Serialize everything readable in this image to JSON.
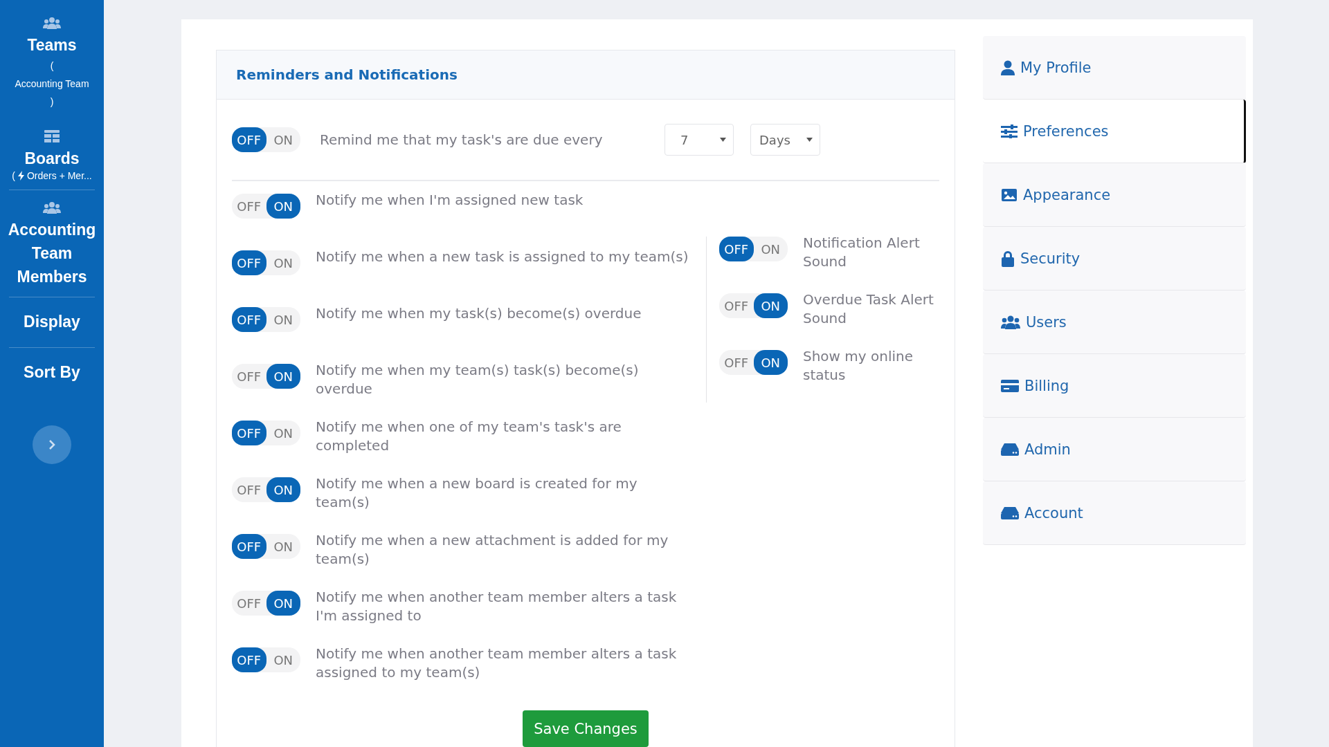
{
  "sidebar": {
    "items": [
      {
        "kind": "team",
        "title": "Teams",
        "open": "(",
        "subtitle": "Accounting Team",
        "close": ")"
      },
      {
        "kind": "board",
        "title": "Boards",
        "open": "(",
        "subtitle": "Orders + Mer..."
      },
      {
        "kind": "members",
        "title": "Accounting Team Members"
      },
      {
        "kind": "plain",
        "title": "Display"
      },
      {
        "kind": "plain",
        "title": "Sort By"
      }
    ]
  },
  "panel": {
    "title": "Reminders and Notifications",
    "reminder": {
      "toggle": {
        "off_label": "OFF",
        "on_label": "ON",
        "on": false
      },
      "text": "Remind me that my task's are due every",
      "count": "7",
      "unit": "Days"
    },
    "left_settings": [
      {
        "toggle": {
          "off_label": "OFF",
          "on_label": "ON",
          "on": true
        },
        "text": "Notify me when I'm assigned new task"
      },
      {
        "toggle": {
          "off_label": "OFF",
          "on_label": "ON",
          "on": false
        },
        "text": "Notify me when a new task is assigned to my team(s)"
      },
      {
        "toggle": {
          "off_label": "OFF",
          "on_label": "ON",
          "on": false
        },
        "text": "Notify me when my task(s) become(s) overdue"
      },
      {
        "toggle": {
          "off_label": "OFF",
          "on_label": "ON",
          "on": true
        },
        "text": "Notify me when my team(s) task(s) become(s) overdue"
      },
      {
        "toggle": {
          "off_label": "OFF",
          "on_label": "ON",
          "on": false
        },
        "text": "Notify me when one of my team's task's are completed"
      },
      {
        "toggle": {
          "off_label": "OFF",
          "on_label": "ON",
          "on": true
        },
        "text": "Notify me when a new board is created for my team(s)"
      },
      {
        "toggle": {
          "off_label": "OFF",
          "on_label": "ON",
          "on": false
        },
        "text": "Notify me when a new attachment is added for my team(s)"
      },
      {
        "toggle": {
          "off_label": "OFF",
          "on_label": "ON",
          "on": true
        },
        "text": "Notify me when another team member alters a task I'm assigned to"
      },
      {
        "toggle": {
          "off_label": "OFF",
          "on_label": "ON",
          "on": false
        },
        "text": "Notify me when another team member alters a task assigned to my team(s)"
      }
    ],
    "right_settings": [
      {
        "toggle": {
          "off_label": "OFF",
          "on_label": "ON",
          "on": false
        },
        "text": "Notification Alert Sound"
      },
      {
        "toggle": {
          "off_label": "OFF",
          "on_label": "ON",
          "on": true
        },
        "text": "Overdue Task Alert Sound"
      },
      {
        "toggle": {
          "off_label": "OFF",
          "on_label": "ON",
          "on": true
        },
        "text": "Show my online status"
      }
    ],
    "save_button": "Save Changes"
  },
  "nav": {
    "items": [
      {
        "label": "My Profile",
        "selected": false
      },
      {
        "label": "Preferences",
        "selected": true
      },
      {
        "label": "Appearance",
        "selected": false
      },
      {
        "label": "Security",
        "selected": false
      },
      {
        "label": "Users",
        "selected": false
      },
      {
        "label": "Billing",
        "selected": false
      },
      {
        "label": "Admin",
        "selected": false
      },
      {
        "label": "Account",
        "selected": false
      }
    ]
  }
}
